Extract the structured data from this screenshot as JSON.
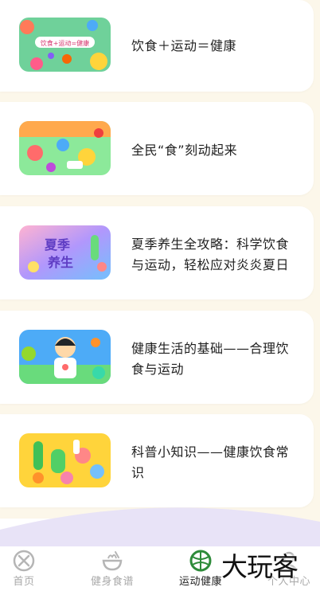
{
  "articles": [
    {
      "title": "饮食＋运动＝健康",
      "thumb_text": "饮食+运动=健康"
    },
    {
      "title": "全民“食”刻动起来"
    },
    {
      "title": "夏季养生全攻略：科学饮食与运动，轻松应对炎炎夏日",
      "thumb_text_1": "夏季",
      "thumb_text_2": "养生"
    },
    {
      "title": "健康生活的基础——合理饮食与运动"
    },
    {
      "title": "科普小知识——健康饮食常识"
    }
  ],
  "tabbar": {
    "tabs": [
      {
        "label": "首页",
        "icon": "home-icon",
        "active": false
      },
      {
        "label": "健身食谱",
        "icon": "bowl-icon",
        "active": false
      },
      {
        "label": "运动健康",
        "icon": "ball-icon",
        "active": true
      },
      {
        "label": "个人中心",
        "icon": "person-icon",
        "active": false
      }
    ]
  },
  "watermark": "大玩客",
  "colors": {
    "background": "#fcf7ea",
    "active_tab_icon": "#2e8b3a",
    "inactive": "#a9a9a9"
  }
}
